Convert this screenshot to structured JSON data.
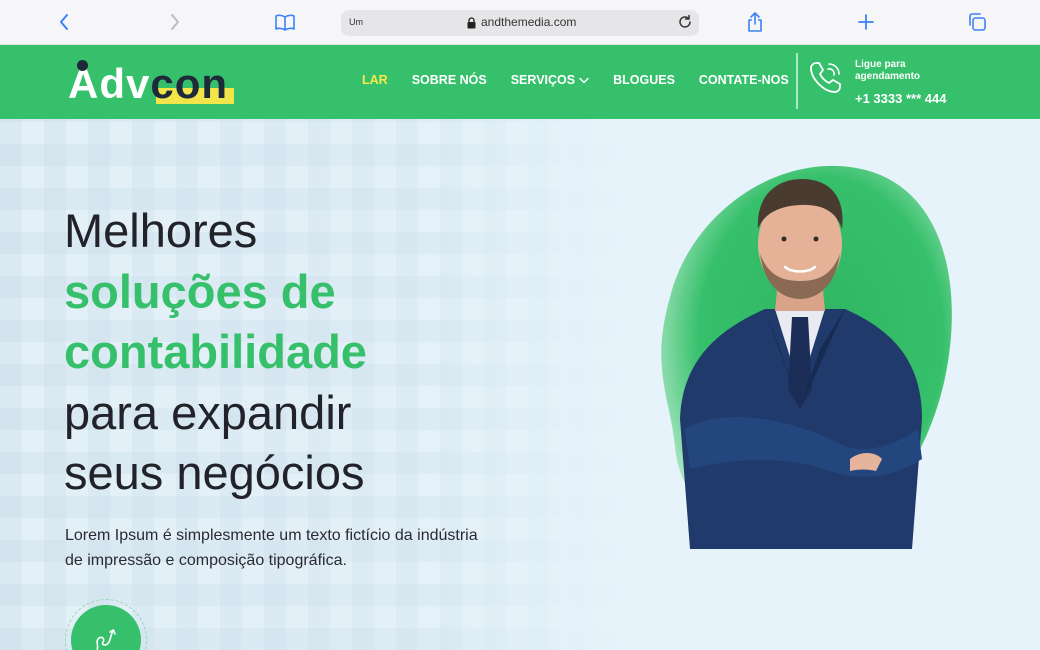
{
  "browser": {
    "tab_label": "Um",
    "url": "andthemedia.com",
    "icons": [
      "back-icon",
      "forward-icon",
      "reader-icon",
      "lock-icon",
      "reload-icon",
      "share-icon",
      "new-tab-icon",
      "tabs-icon"
    ]
  },
  "header": {
    "logo_main": "Adv",
    "logo_accent": "con",
    "menu": [
      {
        "label": "LAR",
        "active": true
      },
      {
        "label": "SOBRE NÓS",
        "active": false
      },
      {
        "label": "SERVIÇOS",
        "active": false,
        "has_dropdown": true
      },
      {
        "label": "BLOGUES",
        "active": false
      },
      {
        "label": "CONTATE-NOS",
        "active": false
      }
    ],
    "call_label": "Ligue para agendamento",
    "call_number": "+1 3333 *** 444"
  },
  "hero": {
    "title_line1": "Melhores",
    "title_line2": "soluções de",
    "title_line3": "contabilidade",
    "title_line4": "para expandir",
    "title_line5": "seus negócios",
    "description": "Lorem Ipsum é simplesmente um texto fictício da indústria de impressão e composição tipográfica."
  },
  "colors": {
    "brand_green": "#37c06b",
    "accent_yellow": "#f6e94b",
    "dark_text": "#22222a",
    "hero_bg": "#e6f3fb"
  }
}
